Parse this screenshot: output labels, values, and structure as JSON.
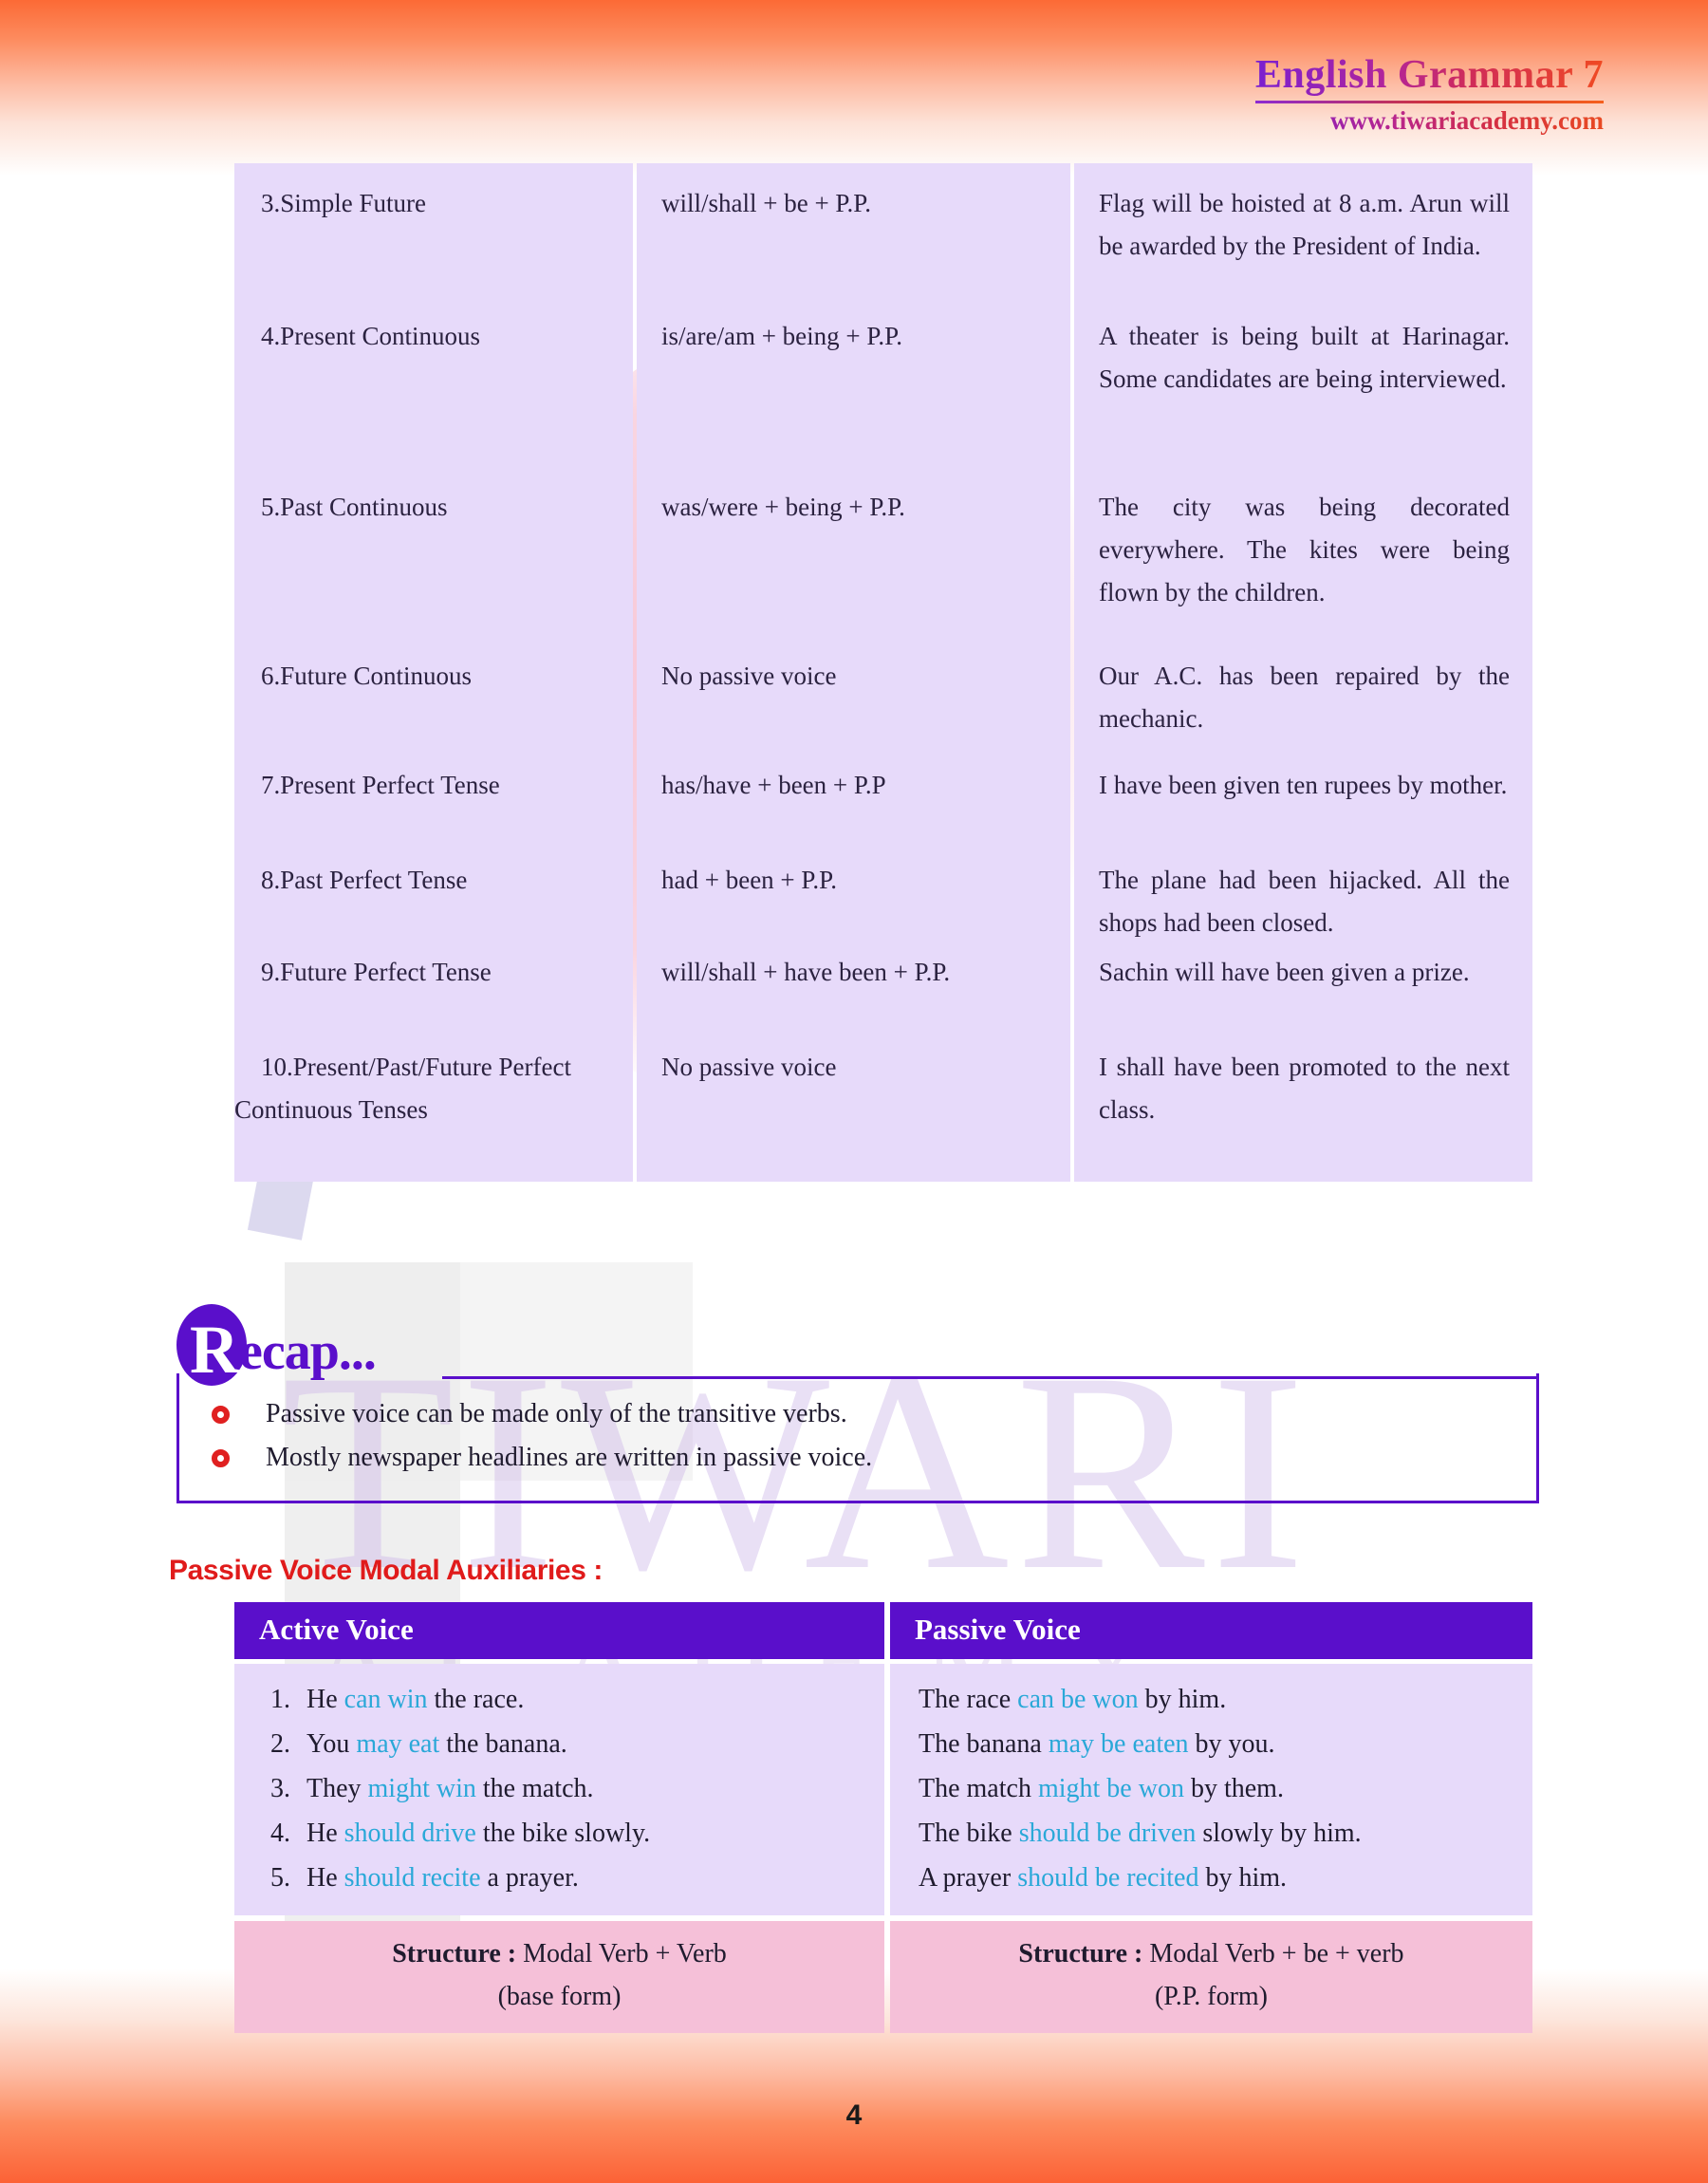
{
  "header": {
    "title": "English Grammar 7",
    "url": "www.tiwariacademy.com"
  },
  "watermark": {
    "line1": "TIWARI",
    "line2": "ACADEMY"
  },
  "tense_table": {
    "rows": [
      {
        "num": "3.",
        "tense": "Simple Future",
        "structure": "will/shall + be + P.P.",
        "examples": "Flag will be hoisted at 8 a.m. Arun will be awarded by the President of India."
      },
      {
        "num": "4.",
        "tense": "Present Continuous",
        "structure": "is/are/am + being + P.P.",
        "examples": "A theater is being built at Harinagar. Some candidates are being interviewed."
      },
      {
        "num": "5.",
        "tense": "Past Continuous",
        "structure": "was/were + being + P.P.",
        "examples": "The city was being decorated everywhere. The kites were being flown by the children."
      },
      {
        "num": "6.",
        "tense": "Future Continuous",
        "structure": "No passive voice",
        "examples": "Our A.C. has been repaired by the mechanic."
      },
      {
        "num": "7.",
        "tense": "Present Perfect Tense",
        "structure": "has/have + been + P.P",
        "examples": "I have been given ten rupees by mother."
      },
      {
        "num": "8.",
        "tense": "Past Perfect Tense",
        "structure": "had + been + P.P.",
        "examples": "The plane had been hijacked. All the shops had been closed."
      },
      {
        "num": "9.",
        "tense": "Future Perfect Tense",
        "structure": "will/shall + have been + P.P.",
        "examples": "Sachin will have been given a prize."
      },
      {
        "num": "10.",
        "tense": "Present/Past/Future Perfect Continuous Tenses",
        "structure": "No passive voice",
        "examples": "I shall have been promoted to the next class."
      }
    ]
  },
  "recap": {
    "badge_letter": "R",
    "title_rest": "ecap...",
    "items": [
      "Passive voice can be made only of the transitive verbs.",
      "Mostly newspaper headlines are written in passive voice."
    ]
  },
  "modal": {
    "heading": "Passive Voice Modal Auxiliaries :",
    "col1_header": "Active Voice",
    "col2_header": "Passive Voice",
    "rows": [
      {
        "num": "1.",
        "active_pre": "He ",
        "active_hl": "can win",
        "active_post": " the race.",
        "passive_pre": "The race ",
        "passive_hl": "can be won",
        "passive_post": " by him."
      },
      {
        "num": "2.",
        "active_pre": "You ",
        "active_hl": "may eat",
        "active_post": " the banana.",
        "passive_pre": "The banana ",
        "passive_hl": "may be eaten",
        "passive_post": " by you."
      },
      {
        "num": "3.",
        "active_pre": "They ",
        "active_hl": "might win",
        "active_post": " the match.",
        "passive_pre": "The match ",
        "passive_hl": "might be won",
        "passive_post": " by them."
      },
      {
        "num": "4.",
        "active_pre": "He ",
        "active_hl": "should drive",
        "active_post": " the bike slowly.",
        "passive_pre": "The bike ",
        "passive_hl": "should be driven",
        "passive_post": " slowly by him."
      },
      {
        "num": "5.",
        "active_pre": "He ",
        "active_hl": "should recite",
        "active_post": " a prayer.",
        "passive_pre": "A prayer ",
        "passive_hl": "should be recited",
        "passive_post": " by him."
      }
    ],
    "structure_label": "Structure :",
    "structure_active_line1": " Modal Verb + Verb",
    "structure_active_line2": "(base form)",
    "structure_passive_line1": " Modal Verb + be + verb",
    "structure_passive_line2": "(P.P. form)"
  },
  "footer": {
    "page_number": "4"
  },
  "colors": {
    "accent_purple": "#5A0FCB",
    "heading_red": "#E01B1B",
    "highlight_cyan": "#2AA8D8",
    "table_lavender": "#E7DAFA",
    "structure_pink": "#F5C0D8",
    "border_orange": "#FC6A35"
  }
}
